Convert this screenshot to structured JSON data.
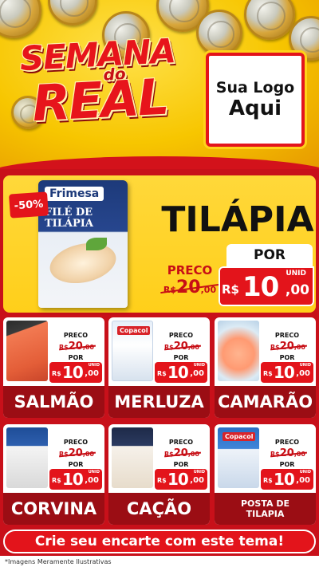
{
  "header": {
    "title_line1": "SEMANA",
    "title_line2": "do",
    "title_line3": "REAL",
    "logo_line1": "Sua Logo",
    "logo_line2": "Aqui"
  },
  "featured": {
    "discount": "-50%",
    "package_brand": "Frimesa",
    "package_name": "FILÉ DE TILÁPIA",
    "name": "TILÁPIA",
    "preco_label": "PRECO",
    "old_currency": "R$",
    "old_int": "20",
    "old_dec": ",00",
    "por_label": "POR",
    "unid_label": "UNID",
    "currency": "R$",
    "price_int": "10",
    "price_dec": ",00"
  },
  "products": [
    {
      "name": "SALMÃO",
      "preco_label": "PRECO",
      "old_currency": "R$",
      "old_int": "20",
      "old_dec": ",00",
      "por_label": "POR",
      "currency": "R$",
      "price_int": "10",
      "price_dec": ",00",
      "unid": "UNID",
      "brand": ""
    },
    {
      "name": "MERLUZA",
      "preco_label": "PRECO",
      "old_currency": "R$",
      "old_int": "20",
      "old_dec": ",00",
      "por_label": "POR",
      "currency": "R$",
      "price_int": "10",
      "price_dec": ",00",
      "unid": "UNID",
      "brand": "Copacol"
    },
    {
      "name": "CAMARÃO",
      "preco_label": "PRECO",
      "old_currency": "R$",
      "old_int": "20",
      "old_dec": ",00",
      "por_label": "POR",
      "currency": "R$",
      "price_int": "10",
      "price_dec": ",00",
      "unid": "UNID",
      "brand": ""
    },
    {
      "name": "CORVINA",
      "preco_label": "PRECO",
      "old_currency": "R$",
      "old_int": "20",
      "old_dec": ",00",
      "por_label": "POR",
      "currency": "R$",
      "price_int": "10",
      "price_dec": ",00",
      "unid": "UNID",
      "brand": ""
    },
    {
      "name": "CAÇÃO",
      "preco_label": "PRECO",
      "old_currency": "R$",
      "old_int": "20",
      "old_dec": ",00",
      "por_label": "POR",
      "currency": "R$",
      "price_int": "10",
      "price_dec": ",00",
      "unid": "UNID",
      "brand": ""
    },
    {
      "name": "POSTA DE TILAPIA",
      "preco_label": "PRECO",
      "old_currency": "R$",
      "old_int": "20",
      "old_dec": ",00",
      "por_label": "POR",
      "currency": "R$",
      "price_int": "10",
      "price_dec": ",00",
      "unid": "UNID",
      "brand": "Copacol"
    }
  ],
  "cta": "Crie seu encarte com este tema!",
  "disclaimer": "*Imagens Meramente Ilustrativas",
  "colors": {
    "accent_red": "#e3141b",
    "dark_red": "#9b0d14",
    "yellow": "#ffd21a"
  }
}
